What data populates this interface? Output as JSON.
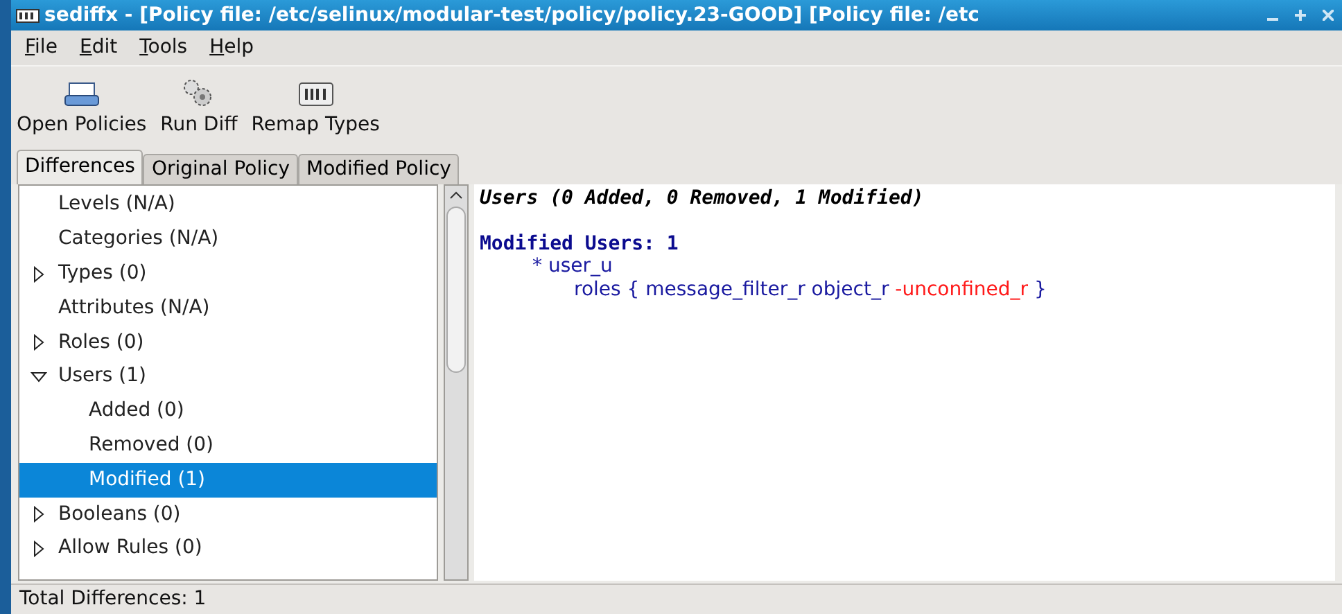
{
  "window": {
    "title": "sediffx - [Policy file: /etc/selinux/modular-test/policy/policy.23-GOOD] [Policy file: /etc"
  },
  "menu": [
    {
      "label": "File"
    },
    {
      "label": "Edit"
    },
    {
      "label": "Tools"
    },
    {
      "label": "Help"
    }
  ],
  "toolbar": [
    {
      "label": "Open Policies",
      "kind": "open"
    },
    {
      "label": "Run Diff",
      "kind": "gears"
    },
    {
      "label": "Remap Types",
      "kind": "remap"
    }
  ],
  "tabs": [
    {
      "label": "Differences",
      "selected": true
    },
    {
      "label": "Original Policy",
      "selected": false
    },
    {
      "label": "Modified Policy",
      "selected": false
    }
  ],
  "tree": [
    {
      "label": "Levels (N/A)",
      "expandable": false,
      "selected": false
    },
    {
      "label": "Categories (N/A)",
      "expandable": false,
      "selected": false
    },
    {
      "label": "Types (0)",
      "expandable": true,
      "expanded": false,
      "selected": false
    },
    {
      "label": "Attributes (N/A)",
      "expandable": false,
      "selected": false
    },
    {
      "label": "Roles (0)",
      "expandable": true,
      "expanded": false,
      "selected": false
    },
    {
      "label": "Users (1)",
      "expandable": true,
      "expanded": true,
      "selected": false,
      "children": [
        {
          "label": "Added (0)",
          "expandable": false,
          "selected": false
        },
        {
          "label": "Removed (0)",
          "expandable": false,
          "selected": false
        },
        {
          "label": "Modified (1)",
          "expandable": false,
          "selected": true
        }
      ]
    },
    {
      "label": "Booleans (0)",
      "expandable": true,
      "expanded": false,
      "selected": false
    },
    {
      "label": "Allow Rules (0)",
      "expandable": true,
      "expanded": false,
      "selected": false
    }
  ],
  "diff": [
    {
      "kind": "summary",
      "text": "Users (0 Added, 0 Removed, 1 Modified)"
    },
    {
      "kind": "blank"
    },
    {
      "kind": "heading",
      "text": "Modified Users: 1"
    },
    {
      "kind": "item",
      "text": "* user_u"
    },
    {
      "kind": "roles",
      "segments": [
        {
          "text": "roles { message_filter_r object_r ",
          "kind": "same"
        },
        {
          "text": "-unconfined_r",
          "kind": "removed"
        },
        {
          "text": " }",
          "kind": "same"
        }
      ]
    }
  ],
  "status_bar": "Total Differences: 1"
}
